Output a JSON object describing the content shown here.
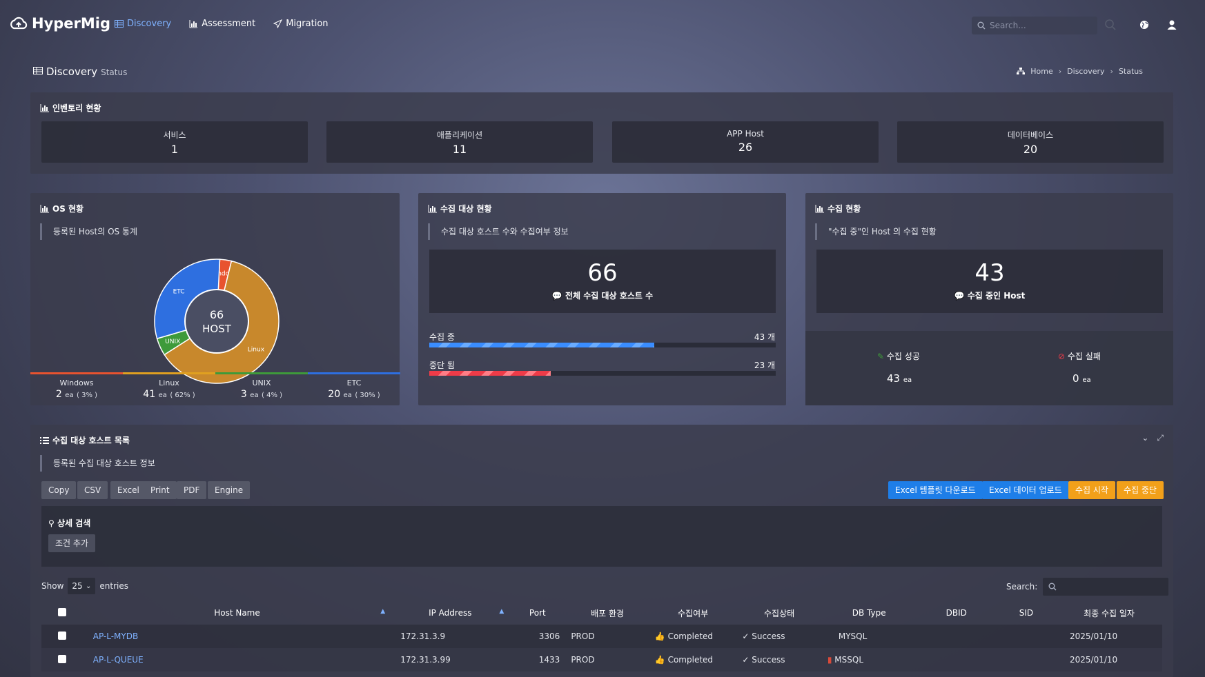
{
  "app": {
    "name": "HyperMig"
  },
  "nav": [
    {
      "label": "Discovery",
      "icon": "table-icon",
      "active": true
    },
    {
      "label": "Assessment",
      "icon": "bar-chart-icon",
      "active": false
    },
    {
      "label": "Migration",
      "icon": "paper-plane-icon",
      "active": false
    }
  ],
  "search_top": {
    "placeholder": "Search..."
  },
  "page": {
    "title": "Discovery",
    "subtitle": "Status"
  },
  "breadcrumb": [
    "Home",
    "Discovery",
    "Status"
  ],
  "inventory": {
    "title": "인벤토리 현황",
    "cards": [
      {
        "label": "서비스",
        "value": "1"
      },
      {
        "label": "애플리케이션",
        "value": "11"
      },
      {
        "label": "APP Host",
        "value": "26"
      },
      {
        "label": "데이터베이스",
        "value": "20"
      }
    ]
  },
  "os_panel": {
    "title": "OS 현황",
    "note": "등록된 Host의 OS 통계",
    "center_value": "66",
    "center_label": "HOST",
    "items": [
      {
        "name": "Windows",
        "count": "2",
        "unit": "ea",
        "pct": "( 3% )",
        "color": "#e8532f",
        "value": 2
      },
      {
        "name": "Linux",
        "count": "41",
        "unit": "ea",
        "pct": "( 62% )",
        "color": "#c8882c",
        "value": 41
      },
      {
        "name": "UNIX",
        "count": "3",
        "unit": "ea",
        "pct": "( 4% )",
        "color": "#3e9a3a",
        "value": 3
      },
      {
        "name": "ETC",
        "count": "20",
        "unit": "ea",
        "pct": "( 30% )",
        "color": "#2e6fe0",
        "value": 20
      }
    ]
  },
  "target_panel": {
    "title": "수집 대상 현황",
    "note": "수집 대상 호스트 수와 수집여부 정보",
    "total": "66",
    "total_caption": "전체 수집 대상 호스트 수",
    "progress": [
      {
        "label": "수집 중",
        "count": "43 개",
        "ratio": 0.65
      },
      {
        "label": "중단 됨",
        "count": "23 개",
        "ratio": 0.35
      }
    ]
  },
  "collect_panel": {
    "title": "수집 현황",
    "note": "\"수집 중\"인 Host 의 수집 현황",
    "value": "43",
    "caption": "수집 중인 Host",
    "success_label": "수집 성공",
    "success_value": "43",
    "fail_label": "수집 실패",
    "fail_value": "0",
    "unit": "ea"
  },
  "hosts_panel": {
    "title": "수집 대상 호스트 목록",
    "note": "등록된 수집 대상 호스트 정보",
    "export_buttons": [
      "Copy",
      "CSV",
      "Excel",
      "Print",
      "PDF",
      "Engine"
    ],
    "action_buttons": [
      "Excel 템플릿 다운로드",
      "Excel 데이터 업로드",
      "수집 시작",
      "수집 중단"
    ],
    "detail_search": "상세 검색",
    "add_condition": "조건 추가",
    "show_label": "Show",
    "page_size": "25",
    "entries_label": "entries",
    "search_label": "Search:",
    "columns": [
      "Host Name",
      "IP Address",
      "Port",
      "배포 환경",
      "수집여부",
      "수집상태",
      "DB Type",
      "DBID",
      "SID",
      "최종 수집 일자"
    ],
    "rows": [
      {
        "host": "AP-L-MYDB",
        "ip": "172.31.3.9",
        "port": "3306",
        "env": "PROD",
        "collect": "Completed",
        "status": "Success",
        "db": "MYSQL",
        "dbid": "",
        "sid": "",
        "date": "2025/01/10"
      },
      {
        "host": "AP-L-QUEUE",
        "ip": "172.31.3.99",
        "port": "1433",
        "env": "PROD",
        "collect": "Completed",
        "status": "Success",
        "db": "MSSQL",
        "dbid": "",
        "sid": "",
        "date": "2025/01/10"
      }
    ]
  }
}
